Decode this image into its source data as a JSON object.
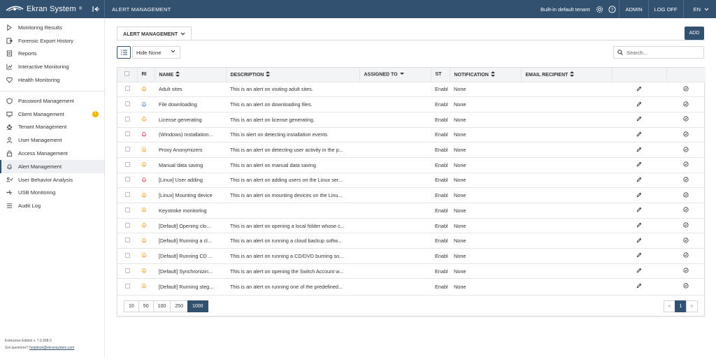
{
  "app": {
    "brand": "Ekran System",
    "brand_mark": "®",
    "section_title": "ALERT MANAGEMENT",
    "tenant": "Built-in default tenant",
    "user": "ADMIN",
    "logoff": "LOG OFF",
    "language": "EN",
    "colors": {
      "header_bg": "#32506f",
      "accent": "#32506f",
      "bell_orange": "#f0a030",
      "bell_blue": "#5b8fc7",
      "bell_red": "#e04858",
      "badge": "#f2b500"
    }
  },
  "sidebar": {
    "group1": [
      {
        "label": "Monitoring Results",
        "icon": "play-icon"
      },
      {
        "label": "Forensic Export History",
        "icon": "export-icon"
      },
      {
        "label": "Reports",
        "icon": "reports-icon"
      },
      {
        "label": "Interactive Monitoring",
        "icon": "chart-icon"
      },
      {
        "label": "Health Monitoring",
        "icon": "heart-icon"
      }
    ],
    "group2": [
      {
        "label": "Password Management",
        "icon": "shield-icon"
      },
      {
        "label": "Client Management",
        "icon": "monitor-icon",
        "badge": "!"
      },
      {
        "label": "Tenant Management",
        "icon": "tenant-icon"
      },
      {
        "label": "User Management",
        "icon": "user-icon"
      },
      {
        "label": "Access Management",
        "icon": "lock-icon"
      },
      {
        "label": "Alert Management",
        "icon": "bell-icon",
        "active": true
      },
      {
        "label": "User Behavior Analysis",
        "icon": "behavior-icon"
      },
      {
        "label": "USB Monitoring",
        "icon": "usb-icon"
      },
      {
        "label": "Audit Log",
        "icon": "list-icon"
      }
    ],
    "footer": {
      "edition": "Enterprise Edition v. 7.0.268.0",
      "questions": "Got questions?",
      "email": "helpdesk@ekransystem.com"
    }
  },
  "toolbar": {
    "tab_label": "ALERT MANAGEMENT",
    "add_label": "ADD",
    "hide_select": "Hide None",
    "search_placeholder": "Search..."
  },
  "table": {
    "columns": [
      "RI",
      "NAME",
      "DESCRIPTION",
      "ASSIGNED TO",
      "ST",
      "NOTIFICATION",
      "EMAIL RECIPIENT"
    ],
    "rows": [
      {
        "risk": "orange",
        "name": "Adult sites",
        "description": "This is an alert on visiting adult sites.",
        "assigned": "",
        "status": "Enabl",
        "notification": "None",
        "email": ""
      },
      {
        "risk": "blue",
        "name": "File downloading",
        "description": "This is an alert on downloading files.",
        "assigned": "",
        "status": "Enabl",
        "notification": "None",
        "email": ""
      },
      {
        "risk": "orange",
        "name": "License generating",
        "description": "This is an alert on license generating.",
        "assigned": "",
        "status": "Enabl",
        "notification": "None",
        "email": ""
      },
      {
        "risk": "red",
        "name": "(Windows) Installation...",
        "description": "This is alert on detecting installation events",
        "assigned": "",
        "status": "Enabl",
        "notification": "None",
        "email": ""
      },
      {
        "risk": "orange",
        "name": "Proxy Anonymizers",
        "description": "This is an alert on detecting user activity in the p...",
        "assigned": "",
        "status": "Enabl",
        "notification": "None",
        "email": ""
      },
      {
        "risk": "orange",
        "name": "Manual data saving",
        "description": "This is an alert on manual data saving",
        "assigned": "",
        "status": "Enabl",
        "notification": "None",
        "email": ""
      },
      {
        "risk": "red",
        "name": "[Linux] User adding",
        "description": "This is an alert on adding users on the Linux ser...",
        "assigned": "",
        "status": "Enabl",
        "notification": "None",
        "email": ""
      },
      {
        "risk": "orange",
        "name": "[Linux] Mounting device",
        "description": "This is an alert on mounting devices on the Linu...",
        "assigned": "",
        "status": "Enabl",
        "notification": "None",
        "email": ""
      },
      {
        "risk": "orange",
        "name": "Keystroke monitoring",
        "description": "",
        "assigned": "",
        "status": "Enabl",
        "notification": "None",
        "email": ""
      },
      {
        "risk": "orange",
        "name": "[Default] Opening clo...",
        "description": "This is an alert on opening a local folder whose c...",
        "assigned": "",
        "status": "Enabl",
        "notification": "None",
        "email": ""
      },
      {
        "risk": "orange",
        "name": "[Default] Running a cl...",
        "description": "This is an alert on running a cloud backup softw...",
        "assigned": "",
        "status": "Enabl",
        "notification": "None",
        "email": ""
      },
      {
        "risk": "orange",
        "name": "[Default] Running CD ...",
        "description": "This is an alert on running a CD/DVD burning so...",
        "assigned": "",
        "status": "Enabl",
        "notification": "None",
        "email": ""
      },
      {
        "risk": "orange",
        "name": "[Default] Synchronizin...",
        "description": "This is an alert on opening the Switch Account w...",
        "assigned": "",
        "status": "Enabl",
        "notification": "None",
        "email": ""
      },
      {
        "risk": "orange",
        "name": "[Default] Running steg...",
        "description": "This is an alert on running one of the predefined...",
        "assigned": "",
        "status": "Enabl",
        "notification": "None",
        "email": ""
      }
    ]
  },
  "pagination": {
    "page_sizes": [
      "10",
      "50",
      "100",
      "250",
      "1000"
    ],
    "active_size": "1000",
    "prev": "«",
    "current_page": "1",
    "next": "»"
  }
}
